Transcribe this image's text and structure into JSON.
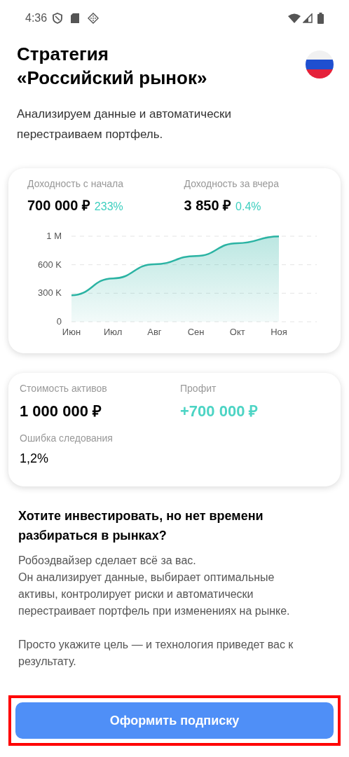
{
  "status_bar": {
    "time": "4:36"
  },
  "title": "Стратегия «Российский рынок»",
  "description": "Анализируем данные и автоматически перестраиваем портфель.",
  "returns_card": {
    "stats": [
      {
        "label": "Доходность с начала",
        "value": "700 000 ₽",
        "change": "233%"
      },
      {
        "label": "Доходность за вчера",
        "value": "3 850 ₽",
        "change": "0.4%"
      }
    ],
    "chart_data": {
      "type": "area",
      "categories": [
        "Июн",
        "Июл",
        "Авг",
        "Сен",
        "Окт",
        "Ноя"
      ],
      "series": [
        {
          "color": "#2bb3a3",
          "values": [
            279000,
            456000,
            605000,
            692000,
            827000,
            898000
          ]
        }
      ],
      "ylim": [
        0,
        900000
      ],
      "yticks": [
        {
          "value": 0,
          "label": "0"
        },
        {
          "value": 300000,
          "label": "300 K"
        },
        {
          "value": 600000,
          "label": "600 K"
        },
        {
          "value": 900000,
          "label": "1 M"
        }
      ]
    }
  },
  "assets_card": {
    "items": [
      {
        "label": "Стоимость активов",
        "value": "1 000 000 ₽",
        "accent": false
      },
      {
        "label": "Профит",
        "value": "+700 000 ₽",
        "accent": true
      },
      {
        "label": "Ошибка следования",
        "value": "1,2%",
        "accent": false
      }
    ]
  },
  "info": {
    "heading": "Хотите инвестировать, но нет времени разбираться в рынках?",
    "paragraphs": [
      "Робоэдвайзер сделает всё за вас.\nОн анализирует данные, выбирает оптимальные активы, контролирует риски и автоматически перестраивает портфель при изменениях на рынке.",
      "Просто укажите цель — и технология приведет вас к результату."
    ]
  },
  "button": {
    "label": "Оформить подписку",
    "highlighted": true
  }
}
